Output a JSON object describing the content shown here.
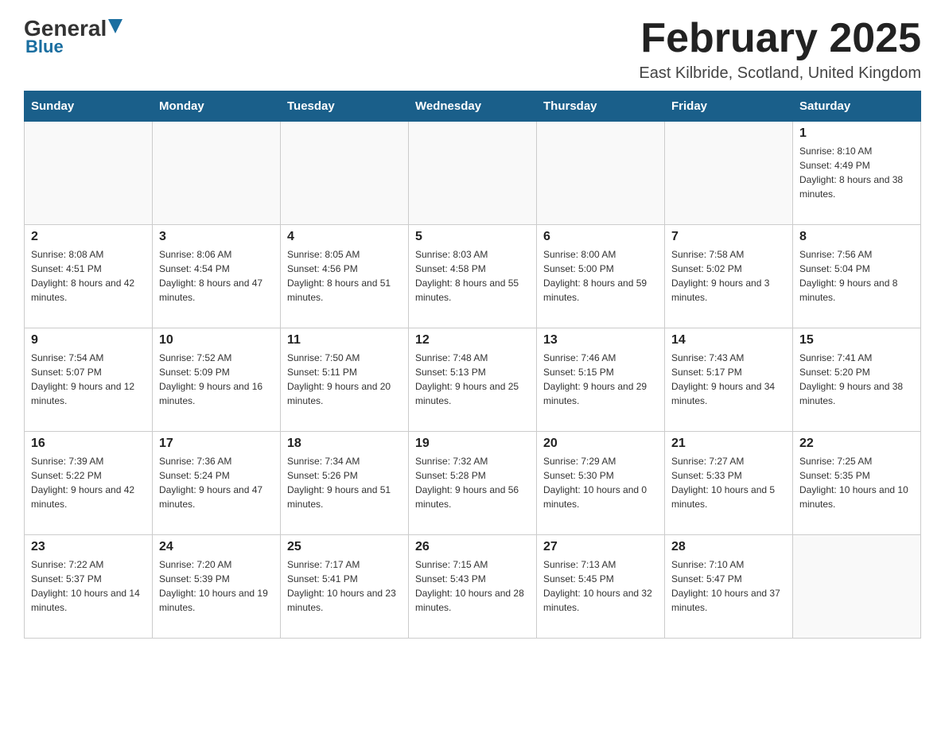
{
  "header": {
    "logo_general": "General",
    "logo_blue": "Blue",
    "title": "February 2025",
    "location": "East Kilbride, Scotland, United Kingdom"
  },
  "calendar": {
    "days_of_week": [
      "Sunday",
      "Monday",
      "Tuesday",
      "Wednesday",
      "Thursday",
      "Friday",
      "Saturday"
    ],
    "weeks": [
      [
        {
          "day": "",
          "info": ""
        },
        {
          "day": "",
          "info": ""
        },
        {
          "day": "",
          "info": ""
        },
        {
          "day": "",
          "info": ""
        },
        {
          "day": "",
          "info": ""
        },
        {
          "day": "",
          "info": ""
        },
        {
          "day": "1",
          "info": "Sunrise: 8:10 AM\nSunset: 4:49 PM\nDaylight: 8 hours and 38 minutes."
        }
      ],
      [
        {
          "day": "2",
          "info": "Sunrise: 8:08 AM\nSunset: 4:51 PM\nDaylight: 8 hours and 42 minutes."
        },
        {
          "day": "3",
          "info": "Sunrise: 8:06 AM\nSunset: 4:54 PM\nDaylight: 8 hours and 47 minutes."
        },
        {
          "day": "4",
          "info": "Sunrise: 8:05 AM\nSunset: 4:56 PM\nDaylight: 8 hours and 51 minutes."
        },
        {
          "day": "5",
          "info": "Sunrise: 8:03 AM\nSunset: 4:58 PM\nDaylight: 8 hours and 55 minutes."
        },
        {
          "day": "6",
          "info": "Sunrise: 8:00 AM\nSunset: 5:00 PM\nDaylight: 8 hours and 59 minutes."
        },
        {
          "day": "7",
          "info": "Sunrise: 7:58 AM\nSunset: 5:02 PM\nDaylight: 9 hours and 3 minutes."
        },
        {
          "day": "8",
          "info": "Sunrise: 7:56 AM\nSunset: 5:04 PM\nDaylight: 9 hours and 8 minutes."
        }
      ],
      [
        {
          "day": "9",
          "info": "Sunrise: 7:54 AM\nSunset: 5:07 PM\nDaylight: 9 hours and 12 minutes."
        },
        {
          "day": "10",
          "info": "Sunrise: 7:52 AM\nSunset: 5:09 PM\nDaylight: 9 hours and 16 minutes."
        },
        {
          "day": "11",
          "info": "Sunrise: 7:50 AM\nSunset: 5:11 PM\nDaylight: 9 hours and 20 minutes."
        },
        {
          "day": "12",
          "info": "Sunrise: 7:48 AM\nSunset: 5:13 PM\nDaylight: 9 hours and 25 minutes."
        },
        {
          "day": "13",
          "info": "Sunrise: 7:46 AM\nSunset: 5:15 PM\nDaylight: 9 hours and 29 minutes."
        },
        {
          "day": "14",
          "info": "Sunrise: 7:43 AM\nSunset: 5:17 PM\nDaylight: 9 hours and 34 minutes."
        },
        {
          "day": "15",
          "info": "Sunrise: 7:41 AM\nSunset: 5:20 PM\nDaylight: 9 hours and 38 minutes."
        }
      ],
      [
        {
          "day": "16",
          "info": "Sunrise: 7:39 AM\nSunset: 5:22 PM\nDaylight: 9 hours and 42 minutes."
        },
        {
          "day": "17",
          "info": "Sunrise: 7:36 AM\nSunset: 5:24 PM\nDaylight: 9 hours and 47 minutes."
        },
        {
          "day": "18",
          "info": "Sunrise: 7:34 AM\nSunset: 5:26 PM\nDaylight: 9 hours and 51 minutes."
        },
        {
          "day": "19",
          "info": "Sunrise: 7:32 AM\nSunset: 5:28 PM\nDaylight: 9 hours and 56 minutes."
        },
        {
          "day": "20",
          "info": "Sunrise: 7:29 AM\nSunset: 5:30 PM\nDaylight: 10 hours and 0 minutes."
        },
        {
          "day": "21",
          "info": "Sunrise: 7:27 AM\nSunset: 5:33 PM\nDaylight: 10 hours and 5 minutes."
        },
        {
          "day": "22",
          "info": "Sunrise: 7:25 AM\nSunset: 5:35 PM\nDaylight: 10 hours and 10 minutes."
        }
      ],
      [
        {
          "day": "23",
          "info": "Sunrise: 7:22 AM\nSunset: 5:37 PM\nDaylight: 10 hours and 14 minutes."
        },
        {
          "day": "24",
          "info": "Sunrise: 7:20 AM\nSunset: 5:39 PM\nDaylight: 10 hours and 19 minutes."
        },
        {
          "day": "25",
          "info": "Sunrise: 7:17 AM\nSunset: 5:41 PM\nDaylight: 10 hours and 23 minutes."
        },
        {
          "day": "26",
          "info": "Sunrise: 7:15 AM\nSunset: 5:43 PM\nDaylight: 10 hours and 28 minutes."
        },
        {
          "day": "27",
          "info": "Sunrise: 7:13 AM\nSunset: 5:45 PM\nDaylight: 10 hours and 32 minutes."
        },
        {
          "day": "28",
          "info": "Sunrise: 7:10 AM\nSunset: 5:47 PM\nDaylight: 10 hours and 37 minutes."
        },
        {
          "day": "",
          "info": ""
        }
      ]
    ]
  }
}
